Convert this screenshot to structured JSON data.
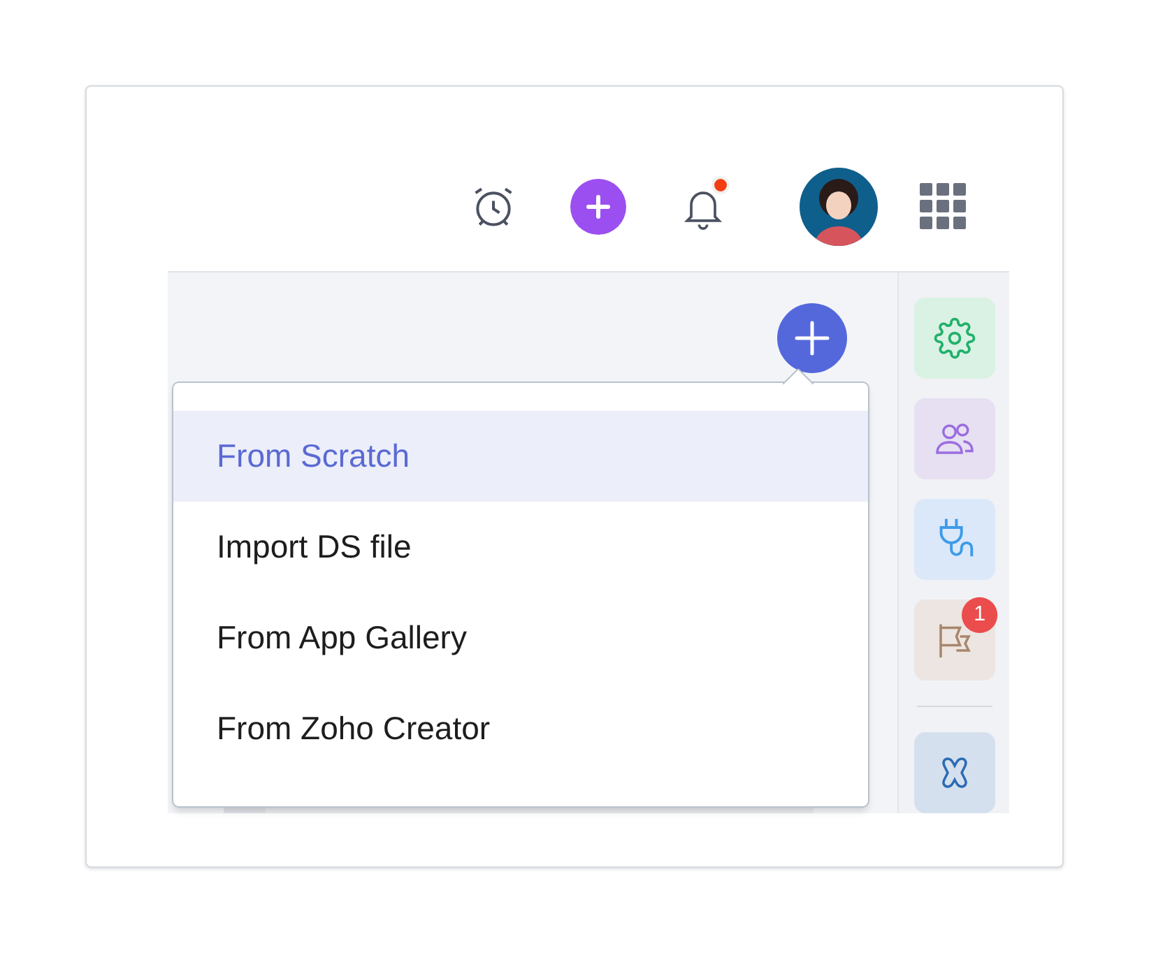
{
  "header": {
    "notification_dot": true
  },
  "menu": {
    "items": [
      {
        "label": "From Scratch",
        "selected": true
      },
      {
        "label": "Import DS file",
        "selected": false
      },
      {
        "label": "From App Gallery",
        "selected": false
      },
      {
        "label": "From Zoho Creator",
        "selected": false
      }
    ]
  },
  "side_rail": {
    "items": [
      {
        "kind": "settings"
      },
      {
        "kind": "users"
      },
      {
        "kind": "plug"
      },
      {
        "kind": "flag",
        "badge": "1"
      },
      {
        "kind": "divider"
      },
      {
        "kind": "connect"
      }
    ]
  }
}
